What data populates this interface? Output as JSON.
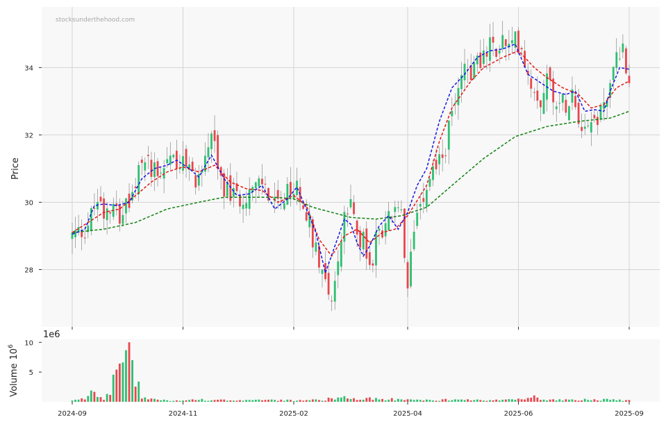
{
  "chart_data": {
    "type": "candlestick",
    "watermark": "stocksunderthehood.com",
    "price_panel": {
      "ylabel": "Price",
      "ylim": [
        26.3,
        35.8
      ],
      "yticks": [
        28,
        30,
        32,
        34
      ],
      "grid": true
    },
    "volume_panel": {
      "ylabel": "Volume",
      "ylabel_exp": "6",
      "offset_text": "1e6",
      "ylim": [
        0,
        10.5
      ],
      "yticks": [
        5,
        10
      ],
      "grid": true
    },
    "x_axis": {
      "ticks": [
        "2024-09",
        "2024-11",
        "2025-02",
        "2025-04",
        "2025-06",
        "2025-09"
      ],
      "tick_index": [
        0,
        40,
        80,
        120,
        160,
        200
      ]
    },
    "colors": {
      "up": "#2fbf71",
      "down": "#e8474c",
      "ma_fast": "#1414e6",
      "ma_mid": "#e61414",
      "ma_slow": "#108010",
      "panel_bg": "#f8f8f8",
      "grid": "#d4d4d4"
    },
    "close_keypoints": [
      [
        0,
        29.0
      ],
      [
        4,
        29.2
      ],
      [
        6,
        29.6
      ],
      [
        8,
        30.2
      ],
      [
        10,
        29.8
      ],
      [
        13,
        30.1
      ],
      [
        15,
        29.7
      ],
      [
        18,
        29.9
      ],
      [
        20,
        30.3
      ],
      [
        22,
        31.3
      ],
      [
        25,
        31.1
      ],
      [
        28,
        31.0
      ],
      [
        31,
        31.4
      ],
      [
        34,
        31.2
      ],
      [
        37,
        30.9
      ],
      [
        40,
        30.7
      ],
      [
        42,
        31.3
      ],
      [
        44,
        32.1
      ],
      [
        46,
        30.9
      ],
      [
        49,
        30.3
      ],
      [
        52,
        30.1
      ],
      [
        55,
        30.3
      ],
      [
        58,
        30.4
      ],
      [
        60,
        30.6
      ],
      [
        63,
        30.0
      ],
      [
        66,
        29.8
      ],
      [
        68,
        30.2
      ],
      [
        71,
        30.4
      ],
      [
        73,
        30.1
      ],
      [
        76,
        29.0
      ],
      [
        78,
        28.4
      ],
      [
        80,
        27.7
      ],
      [
        82,
        27.2
      ],
      [
        84,
        28.2
      ],
      [
        86,
        29.5
      ],
      [
        88,
        29.8
      ],
      [
        90,
        29.2
      ],
      [
        92,
        28.8
      ],
      [
        94,
        28.0
      ],
      [
        96,
        28.8
      ],
      [
        98,
        29.3
      ],
      [
        100,
        29.5
      ],
      [
        102,
        29.8
      ],
      [
        104,
        29.5
      ],
      [
        106,
        27.2
      ],
      [
        108,
        29.4
      ],
      [
        110,
        30.1
      ],
      [
        112,
        30.6
      ],
      [
        114,
        31.0
      ],
      [
        116,
        31.3
      ],
      [
        118,
        31.6
      ],
      [
        120,
        32.6
      ],
      [
        122,
        33.6
      ],
      [
        124,
        34.1
      ],
      [
        126,
        33.8
      ],
      [
        128,
        34.4
      ],
      [
        130,
        34.2
      ],
      [
        132,
        34.6
      ],
      [
        134,
        34.5
      ],
      [
        136,
        34.8
      ],
      [
        138,
        34.5
      ],
      [
        140,
        34.8
      ],
      [
        142,
        34.7
      ],
      [
        144,
        33.8
      ],
      [
        146,
        33.4
      ],
      [
        148,
        33.1
      ],
      [
        150,
        33.7
      ],
      [
        152,
        33.3
      ],
      [
        154,
        32.9
      ],
      [
        156,
        33.0
      ],
      [
        158,
        33.4
      ],
      [
        160,
        32.6
      ],
      [
        162,
        32.3
      ],
      [
        164,
        32.4
      ],
      [
        166,
        32.5
      ],
      [
        168,
        33.0
      ],
      [
        170,
        33.3
      ],
      [
        172,
        34.4
      ],
      [
        174,
        34.6
      ],
      [
        176,
        33.6
      ]
    ],
    "ma_fast_points": [
      [
        0,
        29.05
      ],
      [
        4,
        29.2
      ],
      [
        7,
        29.9
      ],
      [
        10,
        29.95
      ],
      [
        14,
        29.9
      ],
      [
        18,
        30.0
      ],
      [
        22,
        30.7
      ],
      [
        26,
        31.0
      ],
      [
        30,
        31.1
      ],
      [
        33,
        31.25
      ],
      [
        37,
        31.0
      ],
      [
        40,
        30.75
      ],
      [
        44,
        31.4
      ],
      [
        48,
        30.7
      ],
      [
        52,
        30.2
      ],
      [
        56,
        30.25
      ],
      [
        60,
        30.5
      ],
      [
        64,
        29.8
      ],
      [
        68,
        30.1
      ],
      [
        71,
        30.45
      ],
      [
        74,
        29.8
      ],
      [
        77,
        29.1
      ],
      [
        80,
        27.9
      ],
      [
        83,
        28.7
      ],
      [
        86,
        29.5
      ],
      [
        88,
        29.35
      ],
      [
        90,
        28.8
      ],
      [
        92,
        28.4
      ],
      [
        94,
        28.7
      ],
      [
        97,
        29.3
      ],
      [
        100,
        29.6
      ],
      [
        103,
        29.2
      ],
      [
        106,
        29.7
      ],
      [
        109,
        30.5
      ],
      [
        112,
        31.0
      ],
      [
        116,
        32.4
      ],
      [
        120,
        33.4
      ],
      [
        124,
        33.8
      ],
      [
        128,
        34.3
      ],
      [
        132,
        34.5
      ],
      [
        136,
        34.55
      ],
      [
        140,
        34.7
      ],
      [
        144,
        33.8
      ],
      [
        148,
        33.55
      ],
      [
        152,
        33.3
      ],
      [
        156,
        33.2
      ],
      [
        159,
        33.3
      ],
      [
        162,
        32.7
      ],
      [
        165,
        32.75
      ],
      [
        168,
        32.7
      ],
      [
        170,
        33.3
      ],
      [
        173,
        34.0
      ],
      [
        176,
        33.95
      ]
    ],
    "ma_mid_points": [
      [
        0,
        29.1
      ],
      [
        5,
        29.4
      ],
      [
        10,
        29.7
      ],
      [
        15,
        29.8
      ],
      [
        20,
        30.2
      ],
      [
        25,
        30.6
      ],
      [
        30,
        30.9
      ],
      [
        35,
        31.05
      ],
      [
        40,
        30.9
      ],
      [
        45,
        31.1
      ],
      [
        50,
        30.6
      ],
      [
        55,
        30.4
      ],
      [
        60,
        30.35
      ],
      [
        65,
        30.0
      ],
      [
        70,
        30.2
      ],
      [
        74,
        29.9
      ],
      [
        78,
        28.9
      ],
      [
        82,
        28.4
      ],
      [
        86,
        29.0
      ],
      [
        90,
        29.2
      ],
      [
        94,
        28.8
      ],
      [
        98,
        29.1
      ],
      [
        102,
        29.2
      ],
      [
        106,
        29.6
      ],
      [
        112,
        30.5
      ],
      [
        116,
        31.8
      ],
      [
        120,
        32.8
      ],
      [
        126,
        33.6
      ],
      [
        130,
        34.0
      ],
      [
        136,
        34.3
      ],
      [
        141,
        34.5
      ],
      [
        146,
        34.0
      ],
      [
        150,
        33.7
      ],
      [
        155,
        33.4
      ],
      [
        160,
        33.2
      ],
      [
        164,
        32.8
      ],
      [
        168,
        32.9
      ],
      [
        172,
        33.4
      ],
      [
        176,
        33.6
      ]
    ],
    "ma_slow_points": [
      [
        0,
        29.1
      ],
      [
        10,
        29.2
      ],
      [
        20,
        29.4
      ],
      [
        30,
        29.8
      ],
      [
        40,
        30.0
      ],
      [
        48,
        30.15
      ],
      [
        56,
        30.15
      ],
      [
        64,
        30.15
      ],
      [
        70,
        30.1
      ],
      [
        76,
        29.85
      ],
      [
        82,
        29.7
      ],
      [
        88,
        29.55
      ],
      [
        96,
        29.5
      ],
      [
        104,
        29.6
      ],
      [
        112,
        29.85
      ],
      [
        120,
        30.5
      ],
      [
        130,
        31.3
      ],
      [
        140,
        31.95
      ],
      [
        150,
        32.25
      ],
      [
        160,
        32.4
      ],
      [
        170,
        32.5
      ],
      [
        176,
        32.7
      ]
    ],
    "volume_keypoints": [
      [
        0,
        0.2
      ],
      [
        4,
        0.6
      ],
      [
        6,
        1.9
      ],
      [
        10,
        0.5
      ],
      [
        18,
        10.0
      ],
      [
        22,
        0.7
      ],
      [
        30,
        0.3
      ],
      [
        40,
        0.4
      ],
      [
        50,
        0.35
      ],
      [
        60,
        0.3
      ],
      [
        70,
        0.3
      ],
      [
        80,
        0.4
      ],
      [
        84,
        1.0
      ],
      [
        88,
        0.5
      ],
      [
        92,
        0.6
      ],
      [
        96,
        0.8
      ],
      [
        100,
        0.5
      ],
      [
        110,
        0.3
      ],
      [
        120,
        0.4
      ],
      [
        130,
        0.3
      ],
      [
        140,
        0.4
      ],
      [
        146,
        0.9
      ],
      [
        150,
        0.4
      ],
      [
        160,
        0.4
      ],
      [
        170,
        0.4
      ],
      [
        176,
        0.3
      ]
    ],
    "n_bars": 177
  }
}
